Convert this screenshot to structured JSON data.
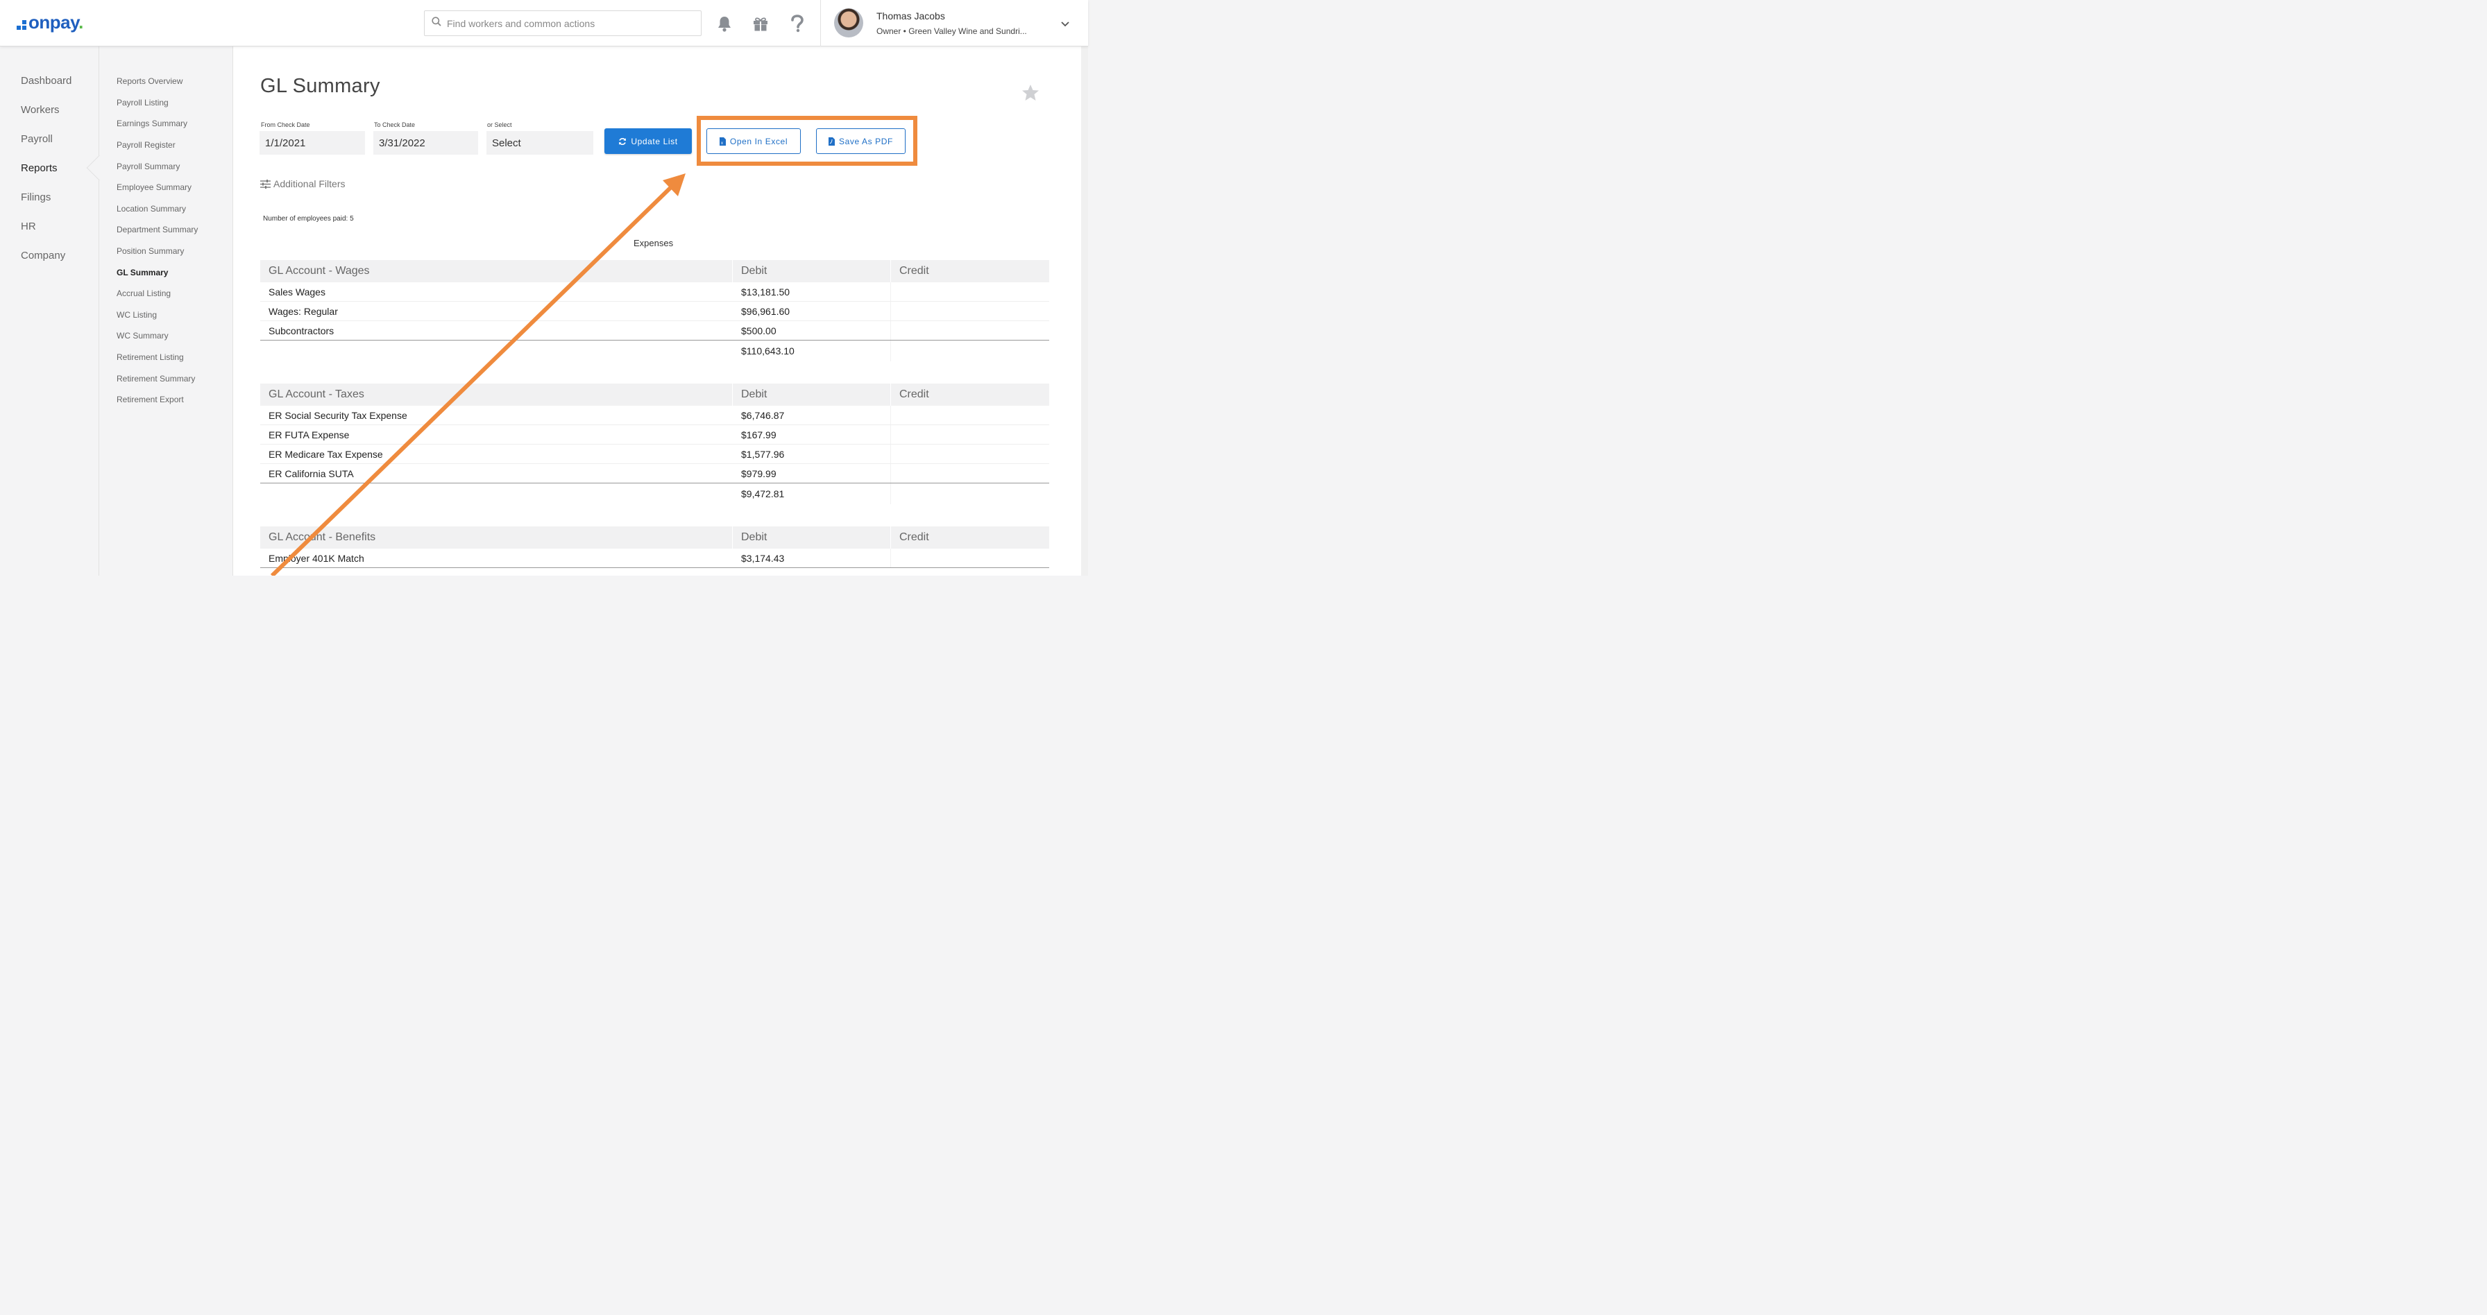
{
  "header": {
    "logo_text": "onpay",
    "logo_dot": ".",
    "search_placeholder": "Find workers and common actions",
    "user_name": "Thomas Jacobs",
    "user_role": "Owner • Green Valley Wine and Sundri..."
  },
  "nav": {
    "items": [
      {
        "label": "Dashboard",
        "active": false
      },
      {
        "label": "Workers",
        "active": false
      },
      {
        "label": "Payroll",
        "active": false
      },
      {
        "label": "Reports",
        "active": true
      },
      {
        "label": "Filings",
        "active": false
      },
      {
        "label": "HR",
        "active": false
      },
      {
        "label": "Company",
        "active": false
      }
    ]
  },
  "subnav": {
    "items": [
      {
        "label": "Reports Overview"
      },
      {
        "label": "Payroll Listing"
      },
      {
        "label": "Earnings Summary"
      },
      {
        "label": "Payroll Register"
      },
      {
        "label": "Payroll Summary"
      },
      {
        "label": "Employee Summary"
      },
      {
        "label": "Location Summary"
      },
      {
        "label": "Department Summary"
      },
      {
        "label": "Position Summary"
      },
      {
        "label": "GL Summary"
      },
      {
        "label": "Accrual Listing"
      },
      {
        "label": "WC Listing"
      },
      {
        "label": "WC Summary"
      },
      {
        "label": "Retirement Listing"
      },
      {
        "label": "Retirement Summary"
      },
      {
        "label": "Retirement Export"
      }
    ]
  },
  "page": {
    "title": "GL Summary",
    "from_label": "From Check Date",
    "from_value": "1/1/2021",
    "to_label": "To Check Date",
    "to_value": "3/31/2022",
    "select_label": "or Select",
    "select_value": "Select",
    "update_button": "Update List",
    "excel_button": "Open In Excel",
    "pdf_button": "Save As PDF",
    "additional_filters": "Additional Filters",
    "employees_paid": "Number of employees paid: 5",
    "section_title": "Expenses"
  },
  "tables": [
    {
      "title": "GL Account - Wages",
      "debit_label": "Debit",
      "credit_label": "Credit",
      "rows": [
        {
          "name": "Sales Wages",
          "debit": "$13,181.50"
        },
        {
          "name": "Wages: Regular",
          "debit": "$96,961.60"
        },
        {
          "name": "Subcontractors",
          "debit": "$500.00"
        }
      ],
      "total": "$110,643.10"
    },
    {
      "title": "GL Account - Taxes",
      "debit_label": "Debit",
      "credit_label": "Credit",
      "rows": [
        {
          "name": "ER Social Security Tax Expense",
          "debit": "$6,746.87"
        },
        {
          "name": "ER FUTA Expense",
          "debit": "$167.99"
        },
        {
          "name": "ER Medicare Tax Expense",
          "debit": "$1,577.96"
        },
        {
          "name": "ER California SUTA",
          "debit": "$979.99"
        }
      ],
      "total": "$9,472.81"
    },
    {
      "title": "GL Account - Benefits",
      "debit_label": "Debit",
      "credit_label": "Credit",
      "rows": [
        {
          "name": "Employer 401K Match",
          "debit": "$3,174.43"
        }
      ],
      "total": ""
    }
  ],
  "colors": {
    "brand": "#1f5fbf",
    "primary_button": "#1f7bd6",
    "highlight": "#ef8b3e"
  }
}
